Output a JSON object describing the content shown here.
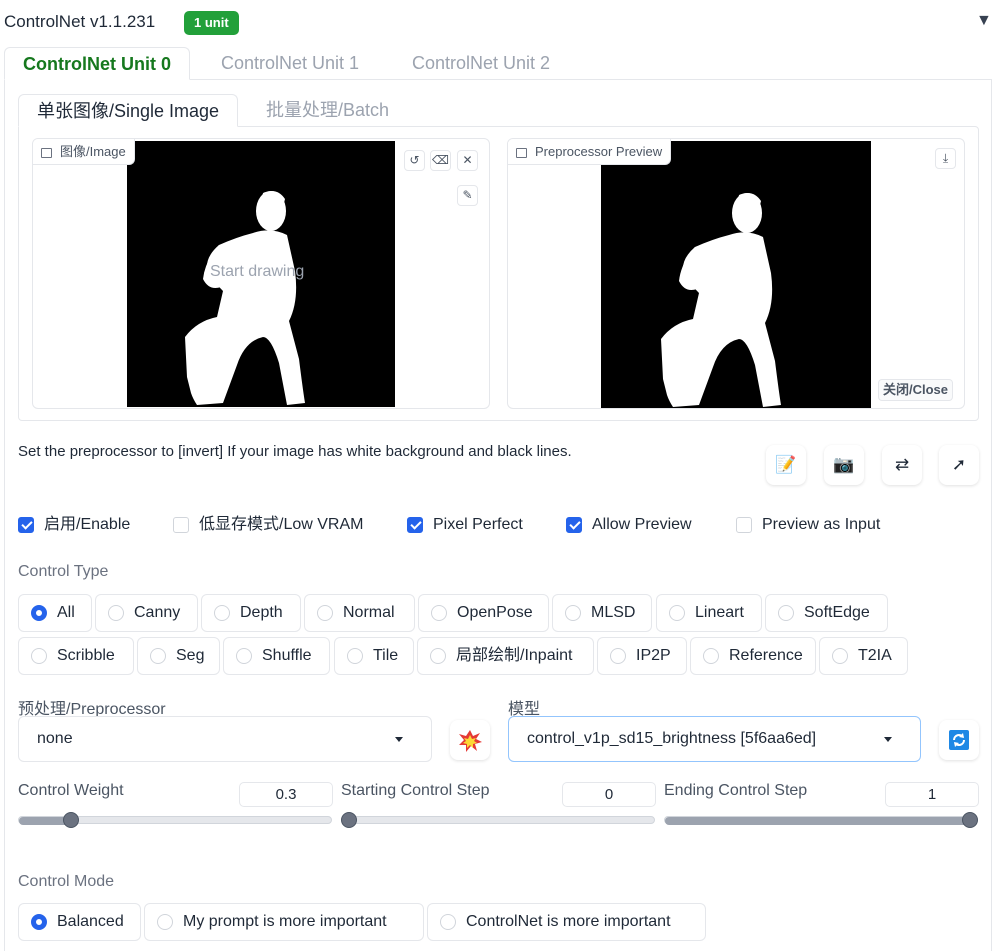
{
  "header": {
    "title": "ControlNet v1.1.231",
    "badge": "1 unit",
    "collapse_glyph": "▼"
  },
  "tabs": [
    {
      "label": "ControlNet Unit 0",
      "active": true
    },
    {
      "label": "ControlNet Unit 1",
      "active": false
    },
    {
      "label": "ControlNet Unit 2",
      "active": false
    }
  ],
  "subtabs": [
    {
      "label": "单张图像/Single Image",
      "active": true
    },
    {
      "label": "批量处理/Batch",
      "active": false
    }
  ],
  "image_panel": {
    "label": "图像/Image",
    "hint": "Start drawing"
  },
  "preview_panel": {
    "label": "Preprocessor Preview",
    "close_label": "关闭/Close"
  },
  "info_text": "Set the preprocessor to [invert] If your image has white background and black lines.",
  "action_icons": [
    "notepad-icon",
    "camera-icon",
    "swap-icon",
    "send-arrow-icon"
  ],
  "checkboxes": [
    {
      "label": "启用/Enable",
      "checked": true
    },
    {
      "label": "低显存模式/Low VRAM",
      "checked": false
    },
    {
      "label": "Pixel Perfect",
      "checked": true
    },
    {
      "label": "Allow Preview",
      "checked": true
    },
    {
      "label": "Preview as Input",
      "checked": false
    }
  ],
  "control_type": {
    "label": "Control Type",
    "options": [
      "All",
      "Canny",
      "Depth",
      "Normal",
      "OpenPose",
      "MLSD",
      "Lineart",
      "SoftEdge",
      "Scribble",
      "Seg",
      "Shuffle",
      "Tile",
      "局部绘制/Inpaint",
      "IP2P",
      "Reference",
      "T2IA"
    ],
    "selected": "All"
  },
  "preprocessor": {
    "label": "预处理/Preprocessor",
    "value": "none"
  },
  "model": {
    "label": "模型",
    "value": "control_v1p_sd15_brightness [5f6aa6ed]"
  },
  "sliders": [
    {
      "label": "Control Weight",
      "value": "0.3",
      "fraction": 0.15
    },
    {
      "label": "Starting Control Step",
      "value": "0",
      "fraction": 0
    },
    {
      "label": "Ending Control Step",
      "value": "1",
      "fraction": 1
    }
  ],
  "control_mode": {
    "label": "Control Mode",
    "options": [
      "Balanced",
      "My prompt is more important",
      "ControlNet is more important"
    ],
    "selected": "Balanced"
  },
  "colors": {
    "accent_green": "#16781e",
    "badge_green": "#22a03a",
    "checkbox_blue": "#2563eb"
  }
}
